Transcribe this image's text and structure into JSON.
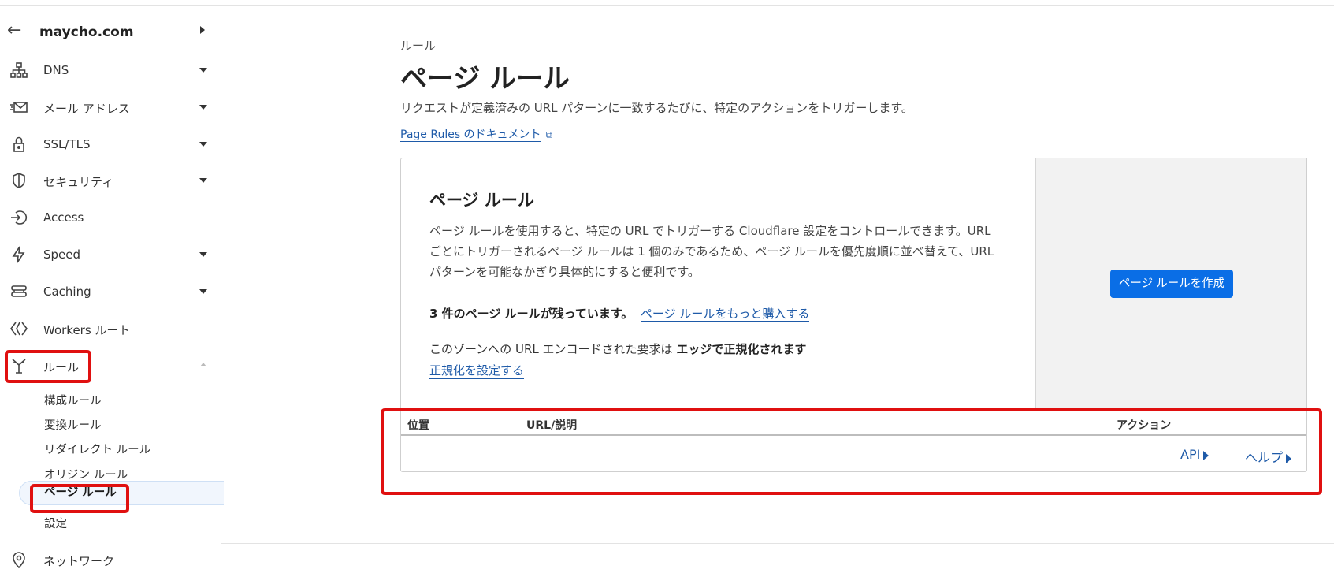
{
  "sidebar": {
    "zone_name": "maycho.com",
    "items": [
      {
        "label": "DNS",
        "icon": "network-icon",
        "expandable": true
      },
      {
        "label": "メール アドレス",
        "icon": "email-icon",
        "expandable": true
      },
      {
        "label": "SSL/TLS",
        "icon": "lock-icon",
        "expandable": true
      },
      {
        "label": "セキュリティ",
        "icon": "shield-icon",
        "expandable": true
      },
      {
        "label": "Access",
        "icon": "access-icon",
        "expandable": false
      },
      {
        "label": "Speed",
        "icon": "lightning-icon",
        "expandable": true
      },
      {
        "label": "Caching",
        "icon": "caching-icon",
        "expandable": true
      },
      {
        "label": "Workers ルート",
        "icon": "workers-icon",
        "expandable": false
      },
      {
        "label": "ルール",
        "icon": "rules-icon",
        "expandable": true
      },
      {
        "label": "ネットワーク",
        "icon": "location-pin-icon",
        "expandable": false
      }
    ],
    "rules_sub": [
      "構成ルール",
      "変換ルール",
      "リダイレクト ルール",
      "オリジン ルール",
      "ページ ルール",
      "設定"
    ]
  },
  "main": {
    "breadcrumb": "ルール",
    "title": "ページ ルール",
    "description": "リクエストが定義済みの URL パターンに一致するたびに、特定のアクションをトリガーします。",
    "docs_link": "Page Rules のドキュメント"
  },
  "card": {
    "title": "ページ ルール",
    "description": "ページ ルールを使用すると、特定の URL でトリガーする Cloudflare 設定をコントロールできます。URL ごとにトリガーされるページ ルールは 1 個のみであるため、ページ ルールを優先度順に並べ替えて、URL パターンを可能なかぎり具体的にすると便利です。",
    "remaining": "3 件のページ ルールが残っています。",
    "buy_more": "ページ ルールをもっと購入する",
    "normalize_prefix": "このゾーンへの URL エンコードされた要求は ",
    "normalize_bold": "エッジで正規化されます",
    "normalize_link": "正規化を設定する",
    "create_button": "ページ ルールを作成"
  },
  "table": {
    "columns": [
      "位置",
      "URL/説明",
      "アクション"
    ],
    "api_link": "API",
    "help_link": "ヘルプ"
  },
  "colors": {
    "accent": "#0a6ee6",
    "link": "#1e5aa8",
    "highlight": "#e01010"
  }
}
